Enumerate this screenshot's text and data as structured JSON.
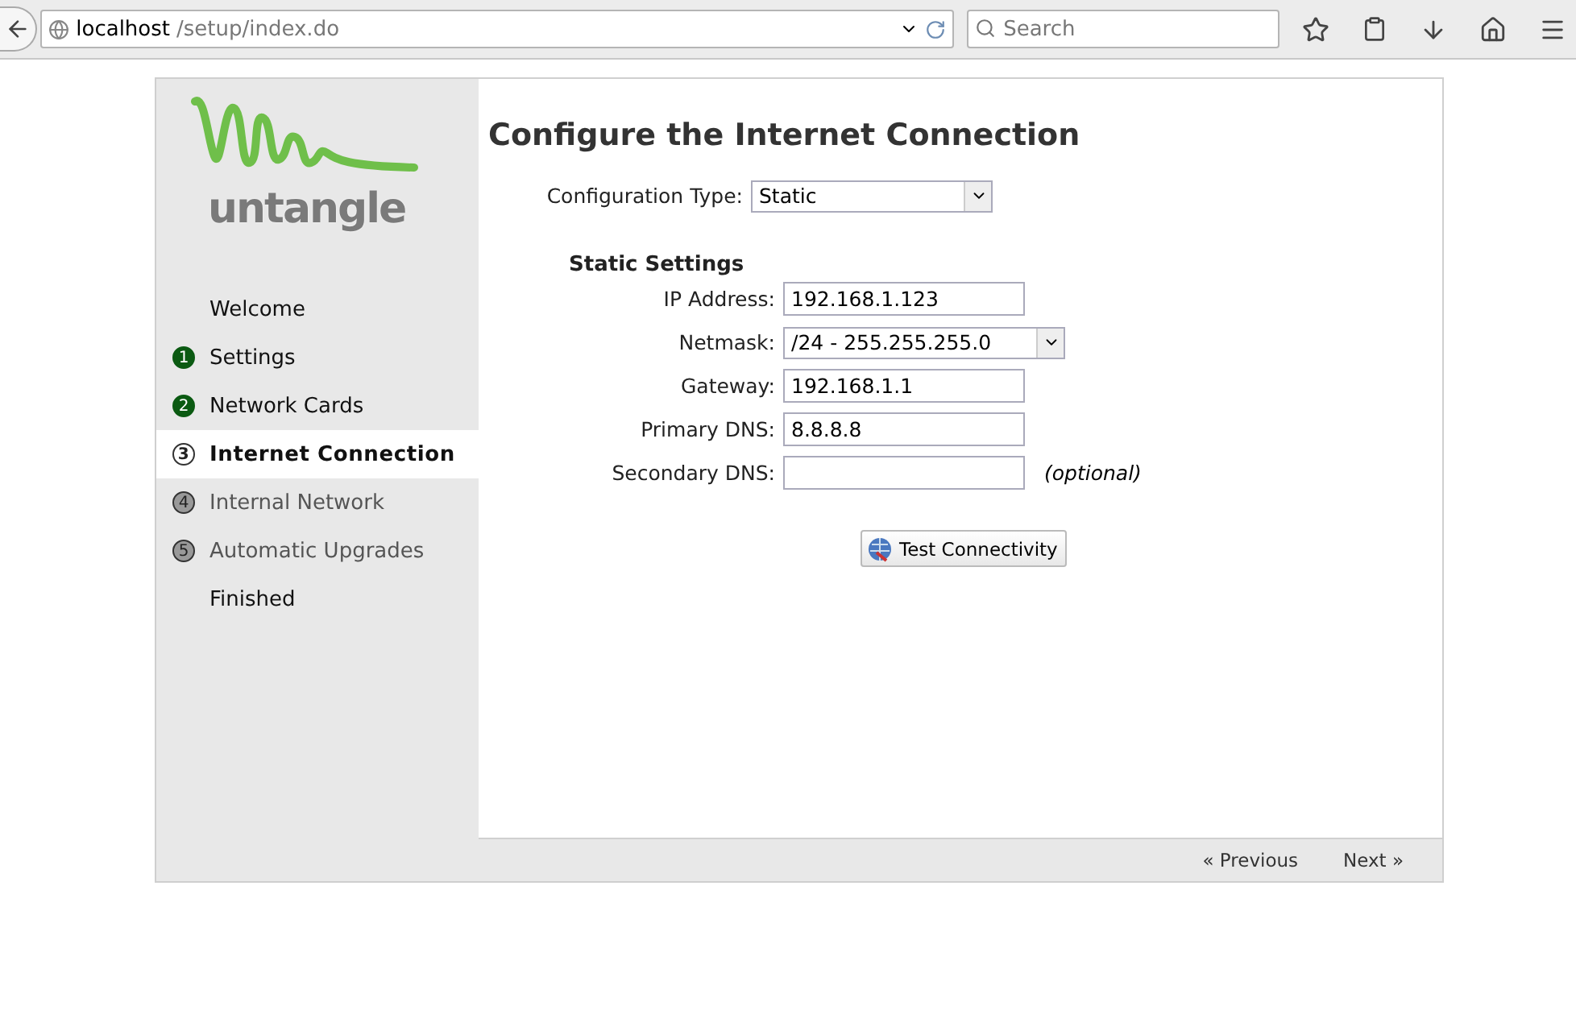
{
  "browser": {
    "url_host": "localhost",
    "url_path": "/setup/index.do",
    "search": {
      "placeholder": "Search"
    }
  },
  "logo": {
    "text": "untangle"
  },
  "steps": [
    {
      "label": "Welcome",
      "disabled": false,
      "selected": false
    },
    {
      "label": "Settings",
      "number": "1",
      "completed": true,
      "disabled": false,
      "selected": false
    },
    {
      "label": "Network Cards",
      "number": "2",
      "completed": true,
      "disabled": false,
      "selected": false
    },
    {
      "label": "Internet Connection",
      "number": "3",
      "completed": false,
      "disabled": false,
      "selected": true
    },
    {
      "label": "Internal Network",
      "number": "4",
      "completed": false,
      "disabled": true,
      "selected": false
    },
    {
      "label": "Automatic Upgrades",
      "number": "5",
      "completed": false,
      "disabled": true,
      "selected": false
    },
    {
      "label": "Finished",
      "disabled": false,
      "selected": false
    }
  ],
  "title": "Configure the Internet Connection",
  "config_type": {
    "label": "Configuration Type:",
    "value": "Static"
  },
  "section_title": "Static Settings",
  "fields": [
    {
      "label": "IP Address:",
      "kind": "text",
      "value": "192.168.1.123"
    },
    {
      "label": "Netmask:",
      "kind": "select",
      "value": "/24 - 255.255.255.0"
    },
    {
      "label": "Gateway:",
      "kind": "text",
      "value": "192.168.1.1"
    },
    {
      "label": "Primary DNS:",
      "kind": "text",
      "value": "8.8.8.8"
    },
    {
      "label": "Secondary DNS:",
      "kind": "text",
      "note": "(optional)"
    }
  ],
  "test_button": "Test Connectivity",
  "footer": {
    "previous": "« Previous",
    "next": "Next »"
  }
}
